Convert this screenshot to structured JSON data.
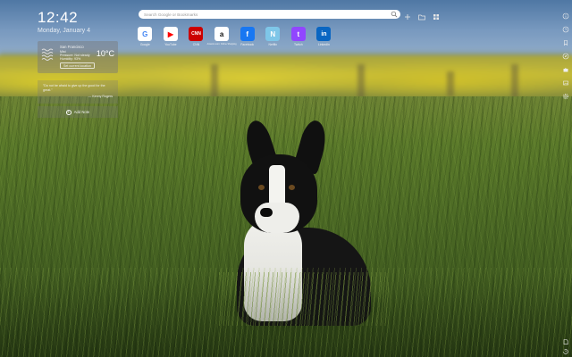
{
  "clock": {
    "time": "12:42",
    "date": "Monday, January 4"
  },
  "weather": {
    "city": "San Francisco",
    "condition": "Mist",
    "line2": "Pressure: Not steady",
    "line3": "Humidity: 93%",
    "temperature": "10°C",
    "location_button": "Set current location",
    "icon": "mist-icon"
  },
  "quote": {
    "text": "\"Do not be afraid to give up the good for the great.\"",
    "author": "— Kenny Rogers"
  },
  "notes": {
    "add_label": "Add Note"
  },
  "search": {
    "placeholder": "Search Google or Bookmarks"
  },
  "top_icons": [
    "screenshot-icon",
    "folder-icon",
    "grid-apps-icon"
  ],
  "tiles": [
    {
      "name": "G",
      "label": "Google",
      "bg": "#ffffff",
      "fg": "#4285f4"
    },
    {
      "name": "▶",
      "label": "YouTube",
      "bg": "#ffffff",
      "fg": "#ff0000"
    },
    {
      "name": "CNN",
      "label": "CNN",
      "bg": "#cc0000",
      "fg": "#ffffff"
    },
    {
      "name": "a",
      "label": "Amazon.com: Online Shopping",
      "bg": "#ffffff",
      "fg": "#111111"
    },
    {
      "name": "f",
      "label": "Facebook",
      "bg": "#1877f2",
      "fg": "#ffffff"
    },
    {
      "name": "N",
      "label": "Netflix",
      "bg": "#7ec6e8",
      "fg": "#ffffff"
    },
    {
      "name": "t",
      "label": "Twitch",
      "bg": "#9146ff",
      "fg": "#ffffff"
    },
    {
      "name": "in",
      "label": "LinkedIn",
      "bg": "#0a66c2",
      "fg": "#ffffff"
    }
  ],
  "rail_icons": [
    "info-icon",
    "clock-icon",
    "bookmark-icon",
    "compass-icon",
    "puzzle-icon",
    "gallery-icon",
    "settings-icon"
  ],
  "rail_bottom_icons": [
    "notes-icon",
    "history-icon"
  ]
}
